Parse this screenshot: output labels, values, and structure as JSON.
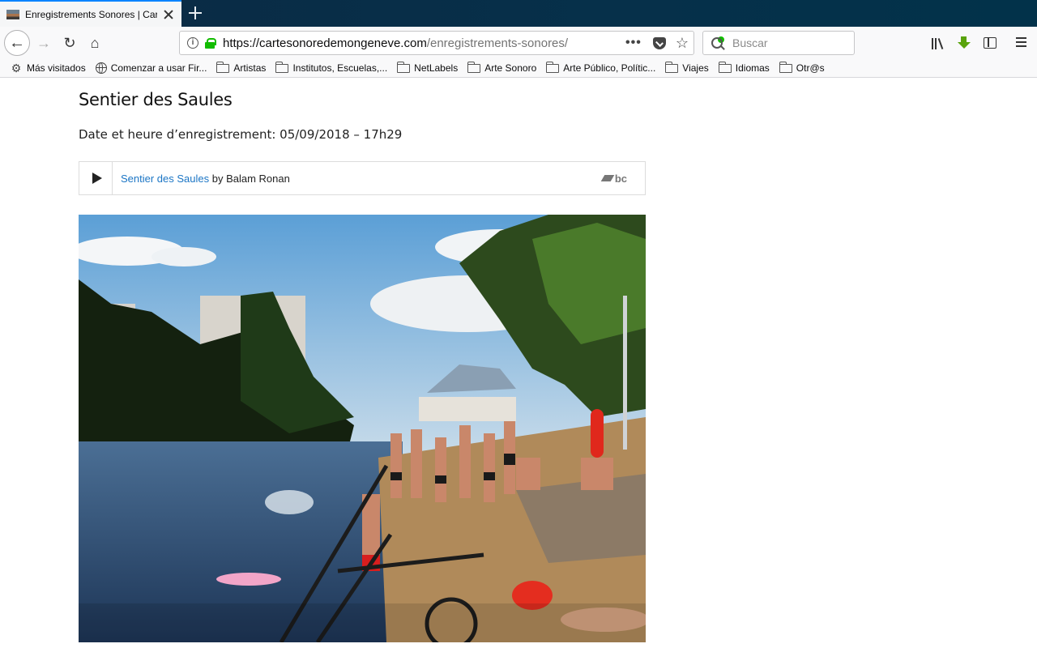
{
  "browser": {
    "tab_title": "Enregistrements Sonores | Carte Sonore de mon Genève",
    "url_domain": "https://cartesonoredemongeneve.com",
    "url_path": "/enregistrements-sonores/",
    "url_more": "•••",
    "search_placeholder": "Buscar",
    "bookmarks": [
      {
        "icon": "gear-icon",
        "label": "Más visitados"
      },
      {
        "icon": "globe-icon",
        "label": "Comenzar a usar Fir..."
      },
      {
        "icon": "folder-icon",
        "label": "Artistas"
      },
      {
        "icon": "folder-icon",
        "label": "Institutos, Escuelas,..."
      },
      {
        "icon": "folder-icon",
        "label": "NetLabels"
      },
      {
        "icon": "folder-icon",
        "label": "Arte Sonoro"
      },
      {
        "icon": "folder-icon",
        "label": "Arte Público, Polític..."
      },
      {
        "icon": "folder-icon",
        "label": "Viajes"
      },
      {
        "icon": "folder-icon",
        "label": "Idiomas"
      },
      {
        "icon": "folder-icon",
        "label": "Otr@s"
      }
    ]
  },
  "page": {
    "title": "Sentier des Saules",
    "record_date": "Date et heure d’enregistrement: 05/09/2018 – 17h29",
    "player": {
      "track_link": "Sentier des Saules",
      "by_text": " by Balam Ronan",
      "logo_text": "bc"
    }
  }
}
